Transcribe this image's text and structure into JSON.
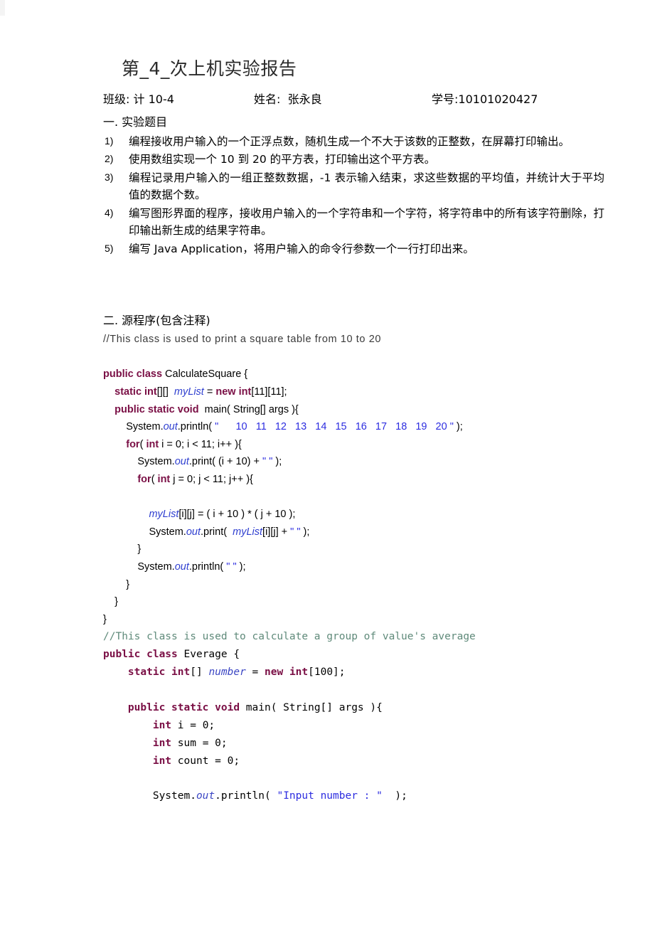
{
  "document": {
    "title": "第_4_次上机实验报告"
  },
  "meta": {
    "class_label": "班级:",
    "class_value": "计 10-4",
    "name_label": "姓名:",
    "name_value": "张永良",
    "id_label": "学号:",
    "id_value": "10101020427"
  },
  "section_one": {
    "heading": "一. 实验题目",
    "items": [
      {
        "num": "1)",
        "text": "编程接收用户输入的一个正浮点数，随机生成一个不大于该数的正整数，在屏幕打印输出。"
      },
      {
        "num": "2)",
        "text": "使用数组实现一个 10 到 20 的平方表，打印输出这个平方表。"
      },
      {
        "num": "3)",
        "text": "编程记录用户输入的一组正整数数据，-1 表示输入结束，求这些数据的平均值，并统计大于平均值的数据个数。"
      },
      {
        "num": "4)",
        "text": "编写图形界面的程序，接收用户输入的一个字符串和一个字符，将字符串中的所有该字符删除，打印输出新生成的结果字符串。"
      },
      {
        "num": "5)",
        "text": "编写 Java Application，将用户输入的命令行参数一个一行打印出来。"
      }
    ]
  },
  "section_two": {
    "heading": "二. 源程序(包含注释)",
    "comment_a": "//This class is used to print a square table from 10 to 20",
    "code_block_a": [
      [
        {
          "t": "public class ",
          "c": "kw"
        },
        {
          "t": "CalculateSquare {",
          "c": "plain"
        }
      ],
      [
        {
          "t": "    ",
          "c": "plain"
        },
        {
          "t": "static int",
          "c": "kw"
        },
        {
          "t": "[][]  ",
          "c": "plain"
        },
        {
          "t": "myList",
          "c": "id"
        },
        {
          "t": " = ",
          "c": "plain"
        },
        {
          "t": "new int",
          "c": "kw"
        },
        {
          "t": "[11][11];",
          "c": "plain"
        }
      ],
      [
        {
          "t": "    ",
          "c": "plain"
        },
        {
          "t": "public static void",
          "c": "kw"
        },
        {
          "t": "  main( String[] args ){",
          "c": "plain"
        }
      ],
      [
        {
          "t": "        System.",
          "c": "plain"
        },
        {
          "t": "out",
          "c": "id"
        },
        {
          "t": ".println( ",
          "c": "plain"
        },
        {
          "t": "\"      10   11   12   13   14   15   16   17   18   19   20 \"",
          "c": "str"
        },
        {
          "t": " );",
          "c": "plain"
        }
      ],
      [
        {
          "t": "        ",
          "c": "plain"
        },
        {
          "t": "for",
          "c": "kw"
        },
        {
          "t": "( ",
          "c": "plain"
        },
        {
          "t": "int",
          "c": "kw"
        },
        {
          "t": " i = 0; i < 11; i++ ){",
          "c": "plain"
        }
      ],
      [
        {
          "t": "            System.",
          "c": "plain"
        },
        {
          "t": "out",
          "c": "id"
        },
        {
          "t": ".print( (i + 10) + ",
          "c": "plain"
        },
        {
          "t": "\" \"",
          "c": "str"
        },
        {
          "t": " );",
          "c": "plain"
        }
      ],
      [
        {
          "t": "            ",
          "c": "plain"
        },
        {
          "t": "for",
          "c": "kw"
        },
        {
          "t": "( ",
          "c": "plain"
        },
        {
          "t": "int",
          "c": "kw"
        },
        {
          "t": " j = 0; j < 11; j++ ){",
          "c": "plain"
        }
      ],
      [
        {
          "t": "",
          "c": "plain"
        }
      ],
      [
        {
          "t": "                ",
          "c": "plain"
        },
        {
          "t": "myList",
          "c": "id"
        },
        {
          "t": "[i][j] = ( i + 10 ) * ( j + 10 );",
          "c": "plain"
        }
      ],
      [
        {
          "t": "                System.",
          "c": "plain"
        },
        {
          "t": "out",
          "c": "id"
        },
        {
          "t": ".print(  ",
          "c": "plain"
        },
        {
          "t": "myList",
          "c": "id"
        },
        {
          "t": "[i][j] + ",
          "c": "plain"
        },
        {
          "t": "\" \"",
          "c": "str"
        },
        {
          "t": " );",
          "c": "plain"
        }
      ],
      [
        {
          "t": "            }",
          "c": "plain"
        }
      ],
      [
        {
          "t": "            System.",
          "c": "plain"
        },
        {
          "t": "out",
          "c": "id"
        },
        {
          "t": ".println( ",
          "c": "plain"
        },
        {
          "t": "\" \"",
          "c": "str"
        },
        {
          "t": " );",
          "c": "plain"
        }
      ],
      [
        {
          "t": "        }",
          "c": "plain"
        }
      ],
      [
        {
          "t": "    }",
          "c": "plain"
        }
      ],
      [
        {
          "t": "}",
          "c": "plain"
        }
      ]
    ],
    "code_block_b": [
      [
        {
          "t": "//This class is used to calculate a group of value's average",
          "c": "cmt"
        }
      ],
      [
        {
          "t": "public class ",
          "c": "kwb"
        },
        {
          "t": "Everage {",
          "c": "plain"
        }
      ],
      [
        {
          "t": "    ",
          "c": "plain"
        },
        {
          "t": "static int",
          "c": "kwb"
        },
        {
          "t": "[] ",
          "c": "plain"
        },
        {
          "t": "number",
          "c": "idn"
        },
        {
          "t": " = ",
          "c": "plain"
        },
        {
          "t": "new int",
          "c": "kwb"
        },
        {
          "t": "[100];",
          "c": "plain"
        }
      ],
      [
        {
          "t": "",
          "c": "plain"
        }
      ],
      [
        {
          "t": "    ",
          "c": "plain"
        },
        {
          "t": "public static void",
          "c": "kwb"
        },
        {
          "t": " main( String[] args ){",
          "c": "plain"
        }
      ],
      [
        {
          "t": "        ",
          "c": "plain"
        },
        {
          "t": "int",
          "c": "kwb"
        },
        {
          "t": " i = 0;",
          "c": "plain"
        }
      ],
      [
        {
          "t": "        ",
          "c": "plain"
        },
        {
          "t": "int",
          "c": "kwb"
        },
        {
          "t": " sum = 0;",
          "c": "plain"
        }
      ],
      [
        {
          "t": "        ",
          "c": "plain"
        },
        {
          "t": "int",
          "c": "kwb"
        },
        {
          "t": " count = 0;",
          "c": "plain"
        }
      ],
      [
        {
          "t": "",
          "c": "plain"
        }
      ],
      [
        {
          "t": "        System.",
          "c": "plain"
        },
        {
          "t": "out",
          "c": "idn"
        },
        {
          "t": ".println( ",
          "c": "plain"
        },
        {
          "t": "\"Input number : \"",
          "c": "str"
        },
        {
          "t": "  );",
          "c": "plain"
        }
      ]
    ]
  }
}
